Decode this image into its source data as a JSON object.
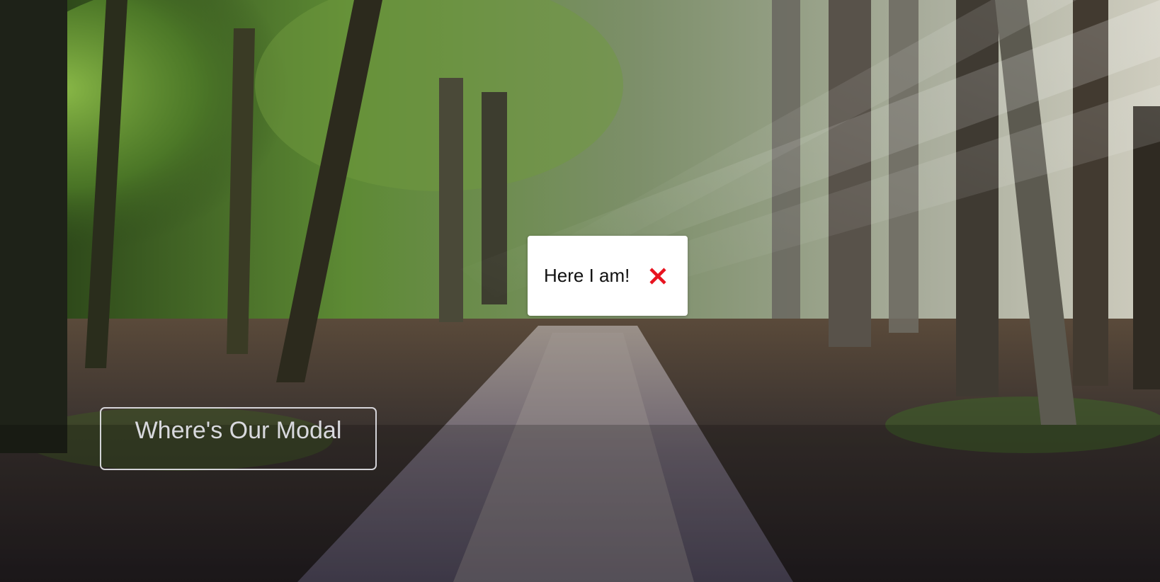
{
  "page": {
    "open_button_label": "Where's Our Modal"
  },
  "modal": {
    "message": "Here I am!",
    "close_icon": "close-icon",
    "close_color": "#e8131f"
  },
  "background": {
    "description_icon": "forest-photo"
  }
}
